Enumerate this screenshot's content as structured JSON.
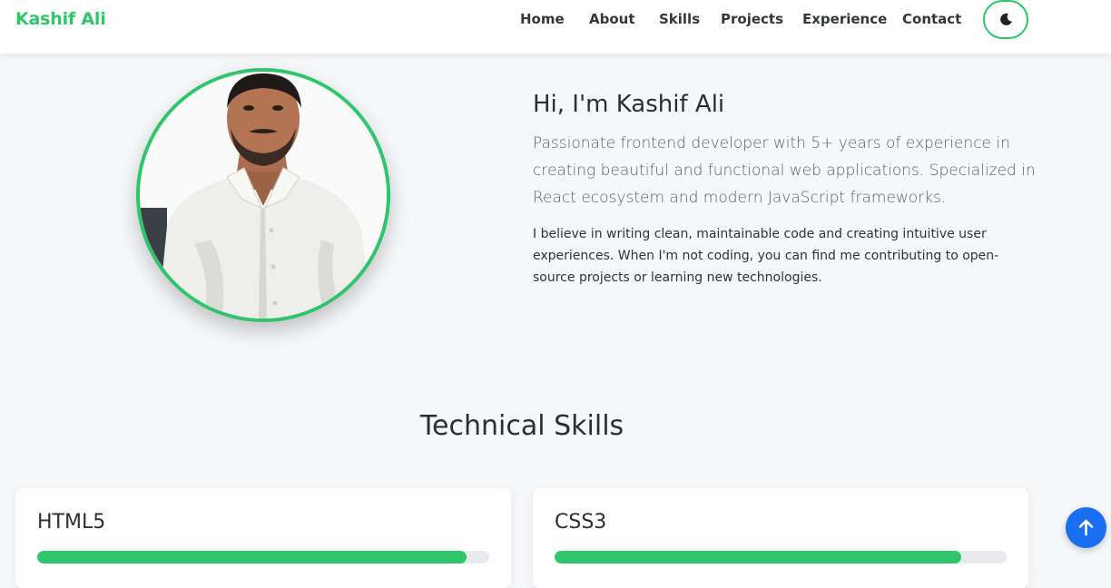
{
  "header": {
    "brand": "Kashif Ali",
    "nav": [
      {
        "label": "Home"
      },
      {
        "label": "About"
      },
      {
        "label": "Skills"
      },
      {
        "label": "Projects"
      },
      {
        "label": "Experience"
      },
      {
        "label": "Contact"
      }
    ],
    "theme_toggle_icon": "moon-icon"
  },
  "hero": {
    "title": "Hi, I'm Kashif Ali",
    "lead": "Passionate frontend developer with 5+ years of experience in creating beautiful and functional web applications. Specialized in React ecosystem and modern JavaScript frameworks.",
    "body": "I believe in writing clean, maintainable code and creating intuitive user experiences. When I'm not coding, you can find me contributing to open-source projects or learning new technologies."
  },
  "skills": {
    "title": "Technical Skills",
    "items": [
      {
        "name": "HTML5",
        "level": 0.95
      },
      {
        "name": "CSS3",
        "level": 0.9
      }
    ]
  },
  "scroll_top_icon": "arrow-up-icon",
  "colors": {
    "accent": "#2ec56b",
    "background": "#f6f7f9",
    "scroll_button": "#1a6ef0",
    "track": "#e8eaed"
  }
}
